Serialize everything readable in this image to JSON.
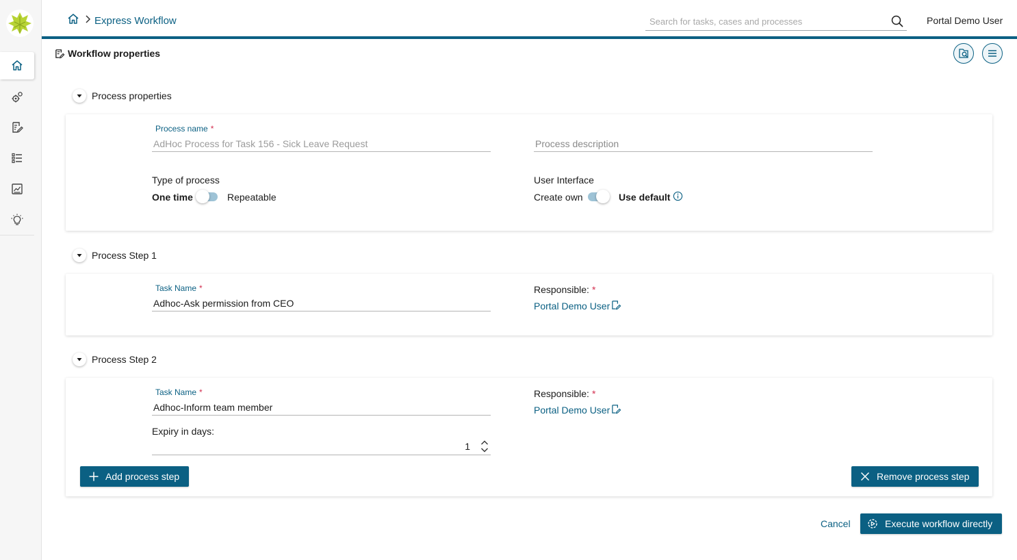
{
  "header": {
    "breadcrumb": {
      "home_icon": "home-icon",
      "current": "Express Workflow"
    },
    "search": {
      "placeholder": "Search for tasks, cases and processes",
      "value": ""
    },
    "user": "Portal Demo User"
  },
  "sidebar": {
    "items": [
      {
        "icon": "home-icon",
        "active": true
      },
      {
        "icon": "gears-icon"
      },
      {
        "icon": "task-edit-icon"
      },
      {
        "icon": "list-icon"
      },
      {
        "icon": "dashboard-chart-icon"
      },
      {
        "icon": "lightbulb-icon"
      }
    ]
  },
  "page": {
    "title": "Workflow properties",
    "actions": [
      "search-doc-icon",
      "menu-icon"
    ]
  },
  "process_properties": {
    "section_title": "Process properties",
    "name_label": "Process name",
    "required_mark": "*",
    "name_value": "AdHoc Process for Task 156 - Sick Leave Request",
    "description_placeholder": "Process description",
    "type_label": "Type of process",
    "type_left": "One time",
    "type_right": "Repeatable",
    "type_selected": "One time",
    "ui_label": "User Interface",
    "ui_left": "Create own",
    "ui_right": "Use default",
    "ui_selected": "Use default"
  },
  "steps": [
    {
      "section_title": "Process Step 1",
      "task_label": "Task Name",
      "task_value": "Adhoc-Ask permission from CEO",
      "responsible_label": "Responsible:",
      "responsible_value": "Portal Demo User"
    },
    {
      "section_title": "Process Step 2",
      "task_label": "Task Name",
      "task_value": "Adhoc-Inform team member",
      "expiry_label": "Expiry in days:",
      "expiry_value": "1",
      "responsible_label": "Responsible:",
      "responsible_value": "Portal Demo User"
    }
  ],
  "buttons": {
    "add_step": "Add process step",
    "remove_step": "Remove process step",
    "cancel": "Cancel",
    "execute": "Execute workflow directly"
  },
  "colors": {
    "accent": "#0b6083",
    "required": "#d32f4f",
    "toggle_track": "#9ec3d6"
  }
}
